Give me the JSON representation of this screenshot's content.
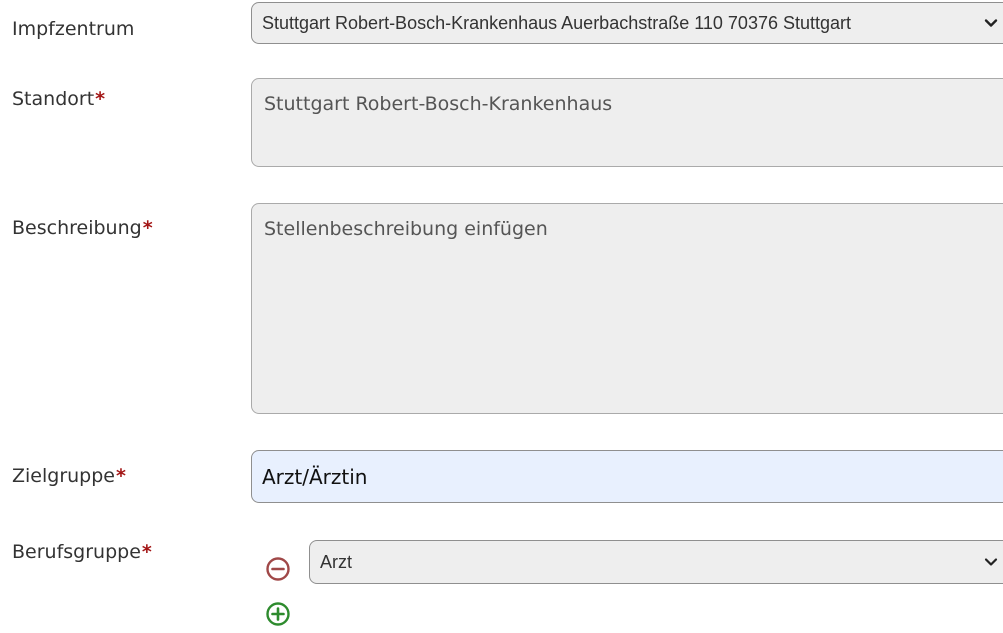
{
  "fields": {
    "impfzentrum": {
      "label": "Impfzentrum",
      "value": "Stuttgart Robert-Bosch-Krankenhaus Auerbachstraße 110 70376 Stuttgart"
    },
    "standort": {
      "label": "Standort",
      "required_mark": "*",
      "value": "Stuttgart Robert-Bosch-Krankenhaus"
    },
    "beschreibung": {
      "label": "Beschreibung",
      "required_mark": "*",
      "value": "Stellenbeschreibung einfügen"
    },
    "zielgruppe": {
      "label": "Zielgruppe",
      "required_mark": "*",
      "value": "Arzt/Ärztin"
    },
    "berufsgruppe": {
      "label": "Berufsgruppe",
      "required_mark": "*",
      "items": [
        {
          "value": "Arzt"
        }
      ],
      "remove_icon": "minus-circle-icon",
      "add_icon": "plus-circle-icon"
    }
  },
  "colors": {
    "required": "#a31515",
    "remove_icon": "#a04848",
    "add_icon": "#2e8b2e",
    "autofill_bg": "#e8f0fe",
    "readonly_bg": "#eeeeee"
  }
}
